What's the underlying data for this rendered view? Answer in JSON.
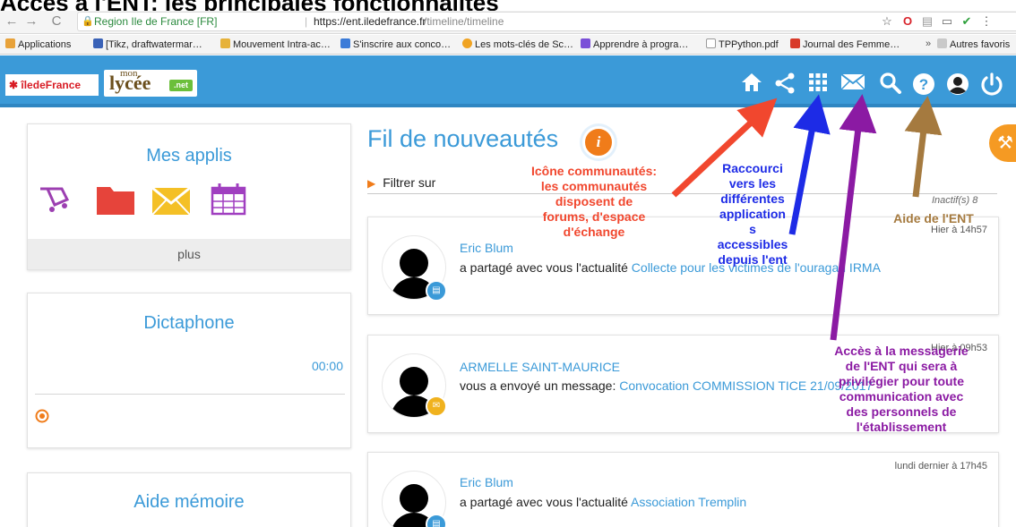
{
  "top_title": "Accès à l'ENT: les principales fonctionnalités",
  "browser": {
    "site_label": "Region Ile de France [FR]",
    "url_host": "https://ent.iledefrance.fr",
    "url_path": "/timeline/timeline",
    "bookmarks": [
      {
        "label": "Applications",
        "color": "#e8a23a"
      },
      {
        "label": "[Tikz, draftwatermar…",
        "color": "#3a62b7"
      },
      {
        "label": "Mouvement Intra-ac…",
        "color": "#e6b23a"
      },
      {
        "label": "S'inscrire aux conco…",
        "color": "#3b7bd8"
      },
      {
        "label": "Les mots-clés de Sc…",
        "color": "#f0a322"
      },
      {
        "label": "Apprendre à progra…",
        "color": "#7a4fd8"
      },
      {
        "label": "TPPython.pdf",
        "color": "#9a9a9a"
      },
      {
        "label": "Journal des Femme…",
        "color": "#d83a2a"
      },
      {
        "label": "Autres favoris",
        "color": "#9a9a9a"
      }
    ],
    "bm_more": "»"
  },
  "header": {
    "brand_region": "îledeFrance",
    "brand_mon": "mon",
    "brand_lycee": "lycée",
    "brand_net": ".net",
    "icons": [
      "home-icon",
      "share-icon",
      "apps-grid-icon",
      "mail-icon",
      "search-icon",
      "help-icon",
      "user-icon",
      "power-icon"
    ]
  },
  "sidebar": {
    "apps_title": "Mes applis",
    "apps_more": "plus",
    "dictaphone_title": "Dictaphone",
    "dictaphone_time": "00:00",
    "memo_title": "Aide mémoire"
  },
  "feed": {
    "title": "Fil de nouveautés",
    "info_badge": "i",
    "filter_label": "Filtrer sur",
    "inactive_label": "Inactif(s) 8",
    "posts": [
      {
        "author": "Eric Blum",
        "action": "a partagé avec vous l'actualité ",
        "link": "Collecte pour les victimes de l'ouragan IRMA",
        "date": "Hier à 14h57",
        "badge_color": "#3b9ad8"
      },
      {
        "author": "ARMELLE SAINT-MAURICE",
        "action": "vous a envoyé un message: ",
        "link": "Convocation COMMISSION TICE 21/09/2017",
        "date": "Hier à 09h53",
        "badge_color": "#f0b21e"
      },
      {
        "author": "Eric Blum",
        "action": "a partagé avec vous l'actualité ",
        "link": "Association Tremplin",
        "date": "lundi dernier à 17h45",
        "badge_color": "#3b9ad8"
      }
    ]
  },
  "annotations": {
    "communities": [
      "Icône communautés:",
      "les communautés",
      "disposent de",
      "forums, d'espace",
      "d'échange"
    ],
    "shortcuts": [
      "Raccourci",
      "vers les",
      "différentes",
      "application",
      "s",
      "accessibles",
      "depuis l'ent"
    ],
    "messaging": [
      "Accès à la messagerie",
      "de l'ENT qui sera à",
      "privilégier pour toute",
      "communication avec",
      "des personnels de",
      "l'établissement"
    ],
    "help": "Aide de l'ENT"
  },
  "colors": {
    "header_blue": "#3b9ad8",
    "annotation_red": "#f1472e",
    "annotation_blue": "#1d2be6",
    "annotation_purple": "#8b1aa3",
    "annotation_brown": "#a57a3f"
  }
}
